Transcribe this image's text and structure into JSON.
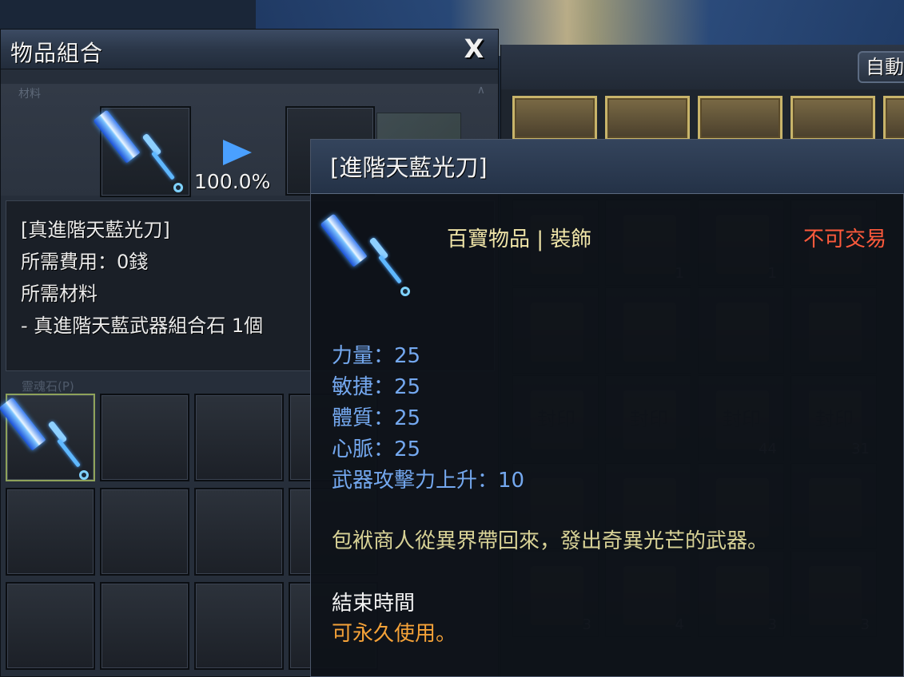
{
  "combine_window": {
    "title": "物品組合",
    "close_label": "X",
    "sub_label": "材料",
    "success_rate": "100.0%",
    "info": {
      "item_name": "[真進階天藍光刀]",
      "fee": "所需費用：0錢",
      "materials_label": "所需材料",
      "material_1": " - 真進階天藍武器組合石 1個"
    },
    "inventory_label": "靈魂石(P)"
  },
  "bag_window": {
    "auto_button": "自動",
    "seal_label": "封印",
    "counts": [
      "1",
      "1",
      "44",
      "31",
      "3",
      "4",
      "3",
      "3"
    ]
  },
  "tooltip": {
    "title": "[進階天藍光刀]",
    "category": "百寶物品 | 裝飾",
    "trade_status": "不可交易",
    "stats": [
      "力量：25",
      "敏捷：25",
      "體質：25",
      "心脈：25",
      "武器攻擊力上升：10"
    ],
    "description": "包袱商人從異界帶回來，發出奇異光芒的武器。",
    "end_time_label": "結束時間",
    "end_time_value": "可永久使用。"
  },
  "colors": {
    "stat": "#74a8ef",
    "trade_status": "#ff5a3c",
    "category": "#f0e5a8",
    "end_time_value": "#f5a238",
    "description": "#d8d296"
  },
  "icons": {
    "item": "blue-sword-icon",
    "arrow": "play-arrow-icon"
  }
}
